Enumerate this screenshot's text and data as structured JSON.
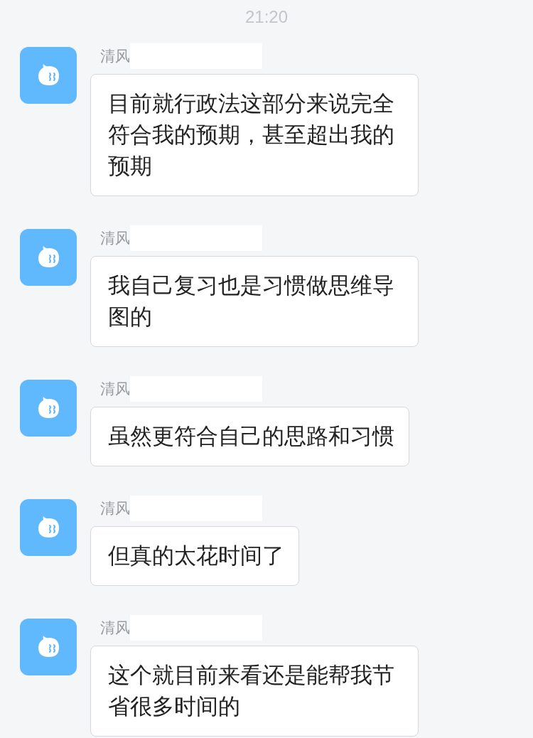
{
  "timestamp": "21:20",
  "messages": [
    {
      "sender": "清风",
      "text": "目前就行政法这部分来说完全符合我的预期，甚至超出我的预期"
    },
    {
      "sender": "清风",
      "text": "我自己复习也是习惯做思维导图的"
    },
    {
      "sender": "清风",
      "text": "虽然更符合自己的思路和习惯"
    },
    {
      "sender": "清风",
      "text": "但真的太花时间了"
    },
    {
      "sender": "清风",
      "text": "这个就目前来看还是能帮我节省很多时间的"
    }
  ]
}
